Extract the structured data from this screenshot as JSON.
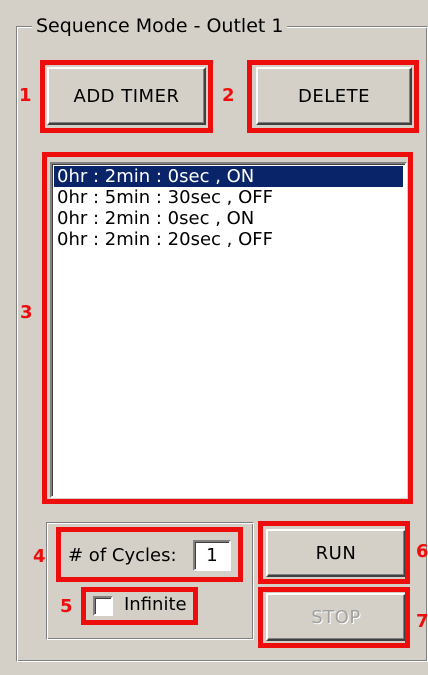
{
  "group": {
    "title": "Sequence Mode - Outlet 1"
  },
  "buttons": {
    "add_timer": "ADD TIMER",
    "delete": "DELETE",
    "run": "RUN",
    "stop": "STOP"
  },
  "timer_list": {
    "items": [
      "0hr : 2min : 0sec , ON",
      "0hr : 5min : 30sec , OFF",
      "0hr : 2min : 0sec , ON",
      "0hr : 2min : 20sec , OFF"
    ],
    "selected_index": 0
  },
  "cycles": {
    "label": "# of Cycles:",
    "value": "1",
    "infinite_label": "Infinite",
    "infinite_checked": false
  },
  "callouts": [
    "1",
    "2",
    "3",
    "4",
    "5",
    "6",
    "7"
  ],
  "colors": {
    "callout": "#ee0d0d",
    "selection": "#0a246a",
    "background": "#d4d0c8"
  }
}
